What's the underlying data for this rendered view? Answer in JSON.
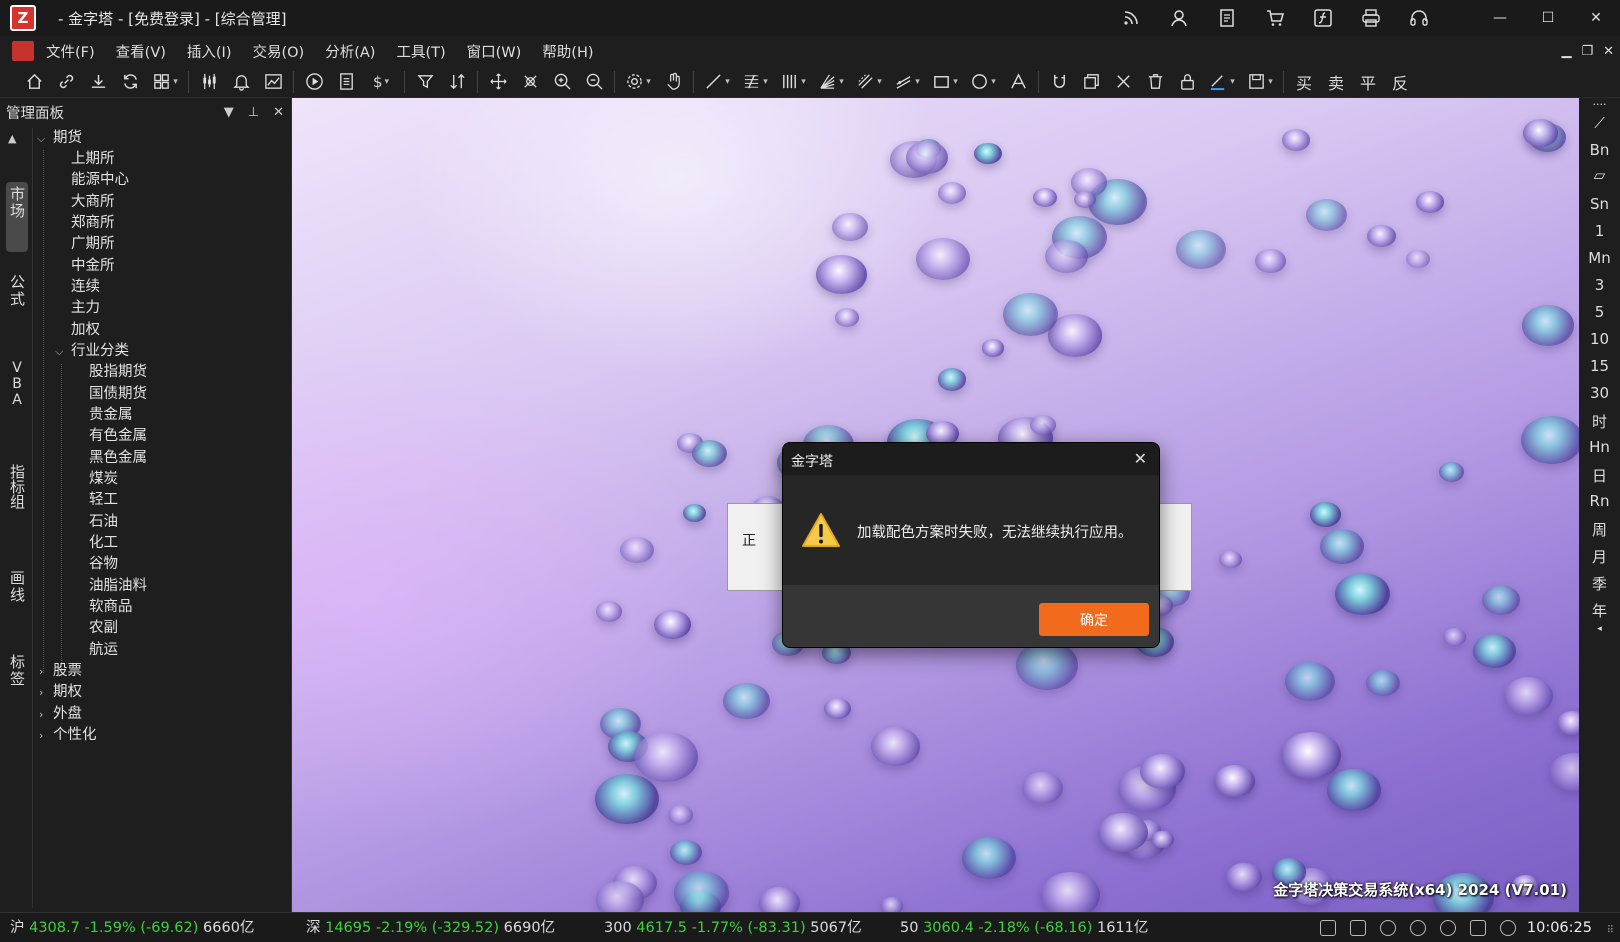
{
  "window": {
    "title": "- 金字塔 - [免费登录] - [综合管理]",
    "logo_glyph": "Z"
  },
  "title_icons": [
    "rss-icon",
    "user-icon",
    "document-icon",
    "cart-icon",
    "formula-icon",
    "printer-icon",
    "headset-icon"
  ],
  "menu": [
    "文件(F)",
    "查看(V)",
    "插入(I)",
    "交易(O)",
    "分析(A)",
    "工具(T)",
    "窗口(W)",
    "帮助(H)"
  ],
  "toolbar": {
    "dollar_glyph": "$",
    "trade_buttons": [
      "买",
      "卖",
      "平",
      "反"
    ]
  },
  "panel": {
    "title": "管理面板",
    "vertical_tabs": [
      "市场",
      "公式",
      "VBA",
      "指标组",
      "画线",
      "标签"
    ],
    "tree": {
      "futures": "期货",
      "exchanges": [
        "上期所",
        "能源中心",
        "大商所",
        "郑商所",
        "广期所",
        "中金所",
        "连续",
        "主力",
        "加权"
      ],
      "industry": "行业分类",
      "industries": [
        "股指期货",
        "国债期货",
        "贵金属",
        "有色金属",
        "黑色金属",
        "煤炭",
        "轻工",
        "石油",
        "化工",
        "谷物",
        "油脂油料",
        "软商品",
        "农副",
        "航运"
      ],
      "others": [
        "股票",
        "期权",
        "外盘",
        "个性化"
      ]
    }
  },
  "splash": {
    "text": "正"
  },
  "dialog": {
    "title": "金字塔",
    "message": "加载配色方案时失败，无法继续执行应用。",
    "ok_label": "确定",
    "accent": "#f26b1d"
  },
  "watermark": "金字塔决策交易系统(x64) 2024 (V7.01)",
  "periods": [
    "Bn",
    "Sn",
    "1",
    "Mn",
    "3",
    "5",
    "10",
    "15",
    "30",
    "时",
    "Hn",
    "日",
    "Rn",
    "周",
    "月",
    "季",
    "年"
  ],
  "status": {
    "indices": [
      {
        "name": "沪",
        "value": "4308.7 -1.59% (-69.62)",
        "amount": "6660亿"
      },
      {
        "name": "深",
        "value": "14695 -2.19% (-329.52)",
        "amount": "6690亿"
      },
      {
        "name": "300",
        "value": "4617.5 -1.77% (-83.31)",
        "amount": "5067亿"
      },
      {
        "name": "50",
        "value": "3060.4 -2.18% (-68.16)",
        "amount": "1611亿"
      }
    ],
    "down_color": "#3cd23c",
    "time": "10:06:25"
  }
}
